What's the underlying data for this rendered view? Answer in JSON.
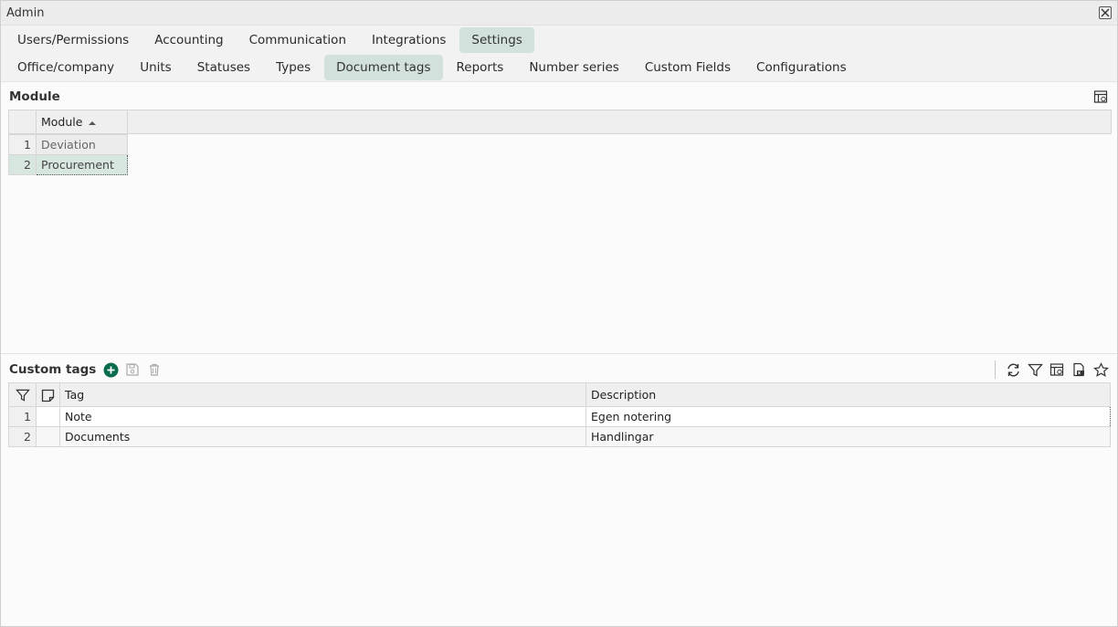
{
  "window": {
    "title": "Admin"
  },
  "tabs_row1": [
    {
      "label": "Users/Permissions"
    },
    {
      "label": "Accounting"
    },
    {
      "label": "Communication"
    },
    {
      "label": "Integrations"
    },
    {
      "label": "Settings",
      "active": true
    }
  ],
  "tabs_row2": [
    {
      "label": "Office/company"
    },
    {
      "label": "Units"
    },
    {
      "label": "Statuses"
    },
    {
      "label": "Types"
    },
    {
      "label": "Document tags",
      "active": true
    },
    {
      "label": "Reports"
    },
    {
      "label": "Number series"
    },
    {
      "label": "Custom Fields"
    },
    {
      "label": "Configurations"
    }
  ],
  "module": {
    "title": "Module",
    "column": "Module",
    "rows": [
      {
        "num": "1",
        "name": "Deviation"
      },
      {
        "num": "2",
        "name": "Procurement"
      }
    ]
  },
  "custom_tags": {
    "title": "Custom tags",
    "columns": {
      "tag": "Tag",
      "description": "Description"
    },
    "rows": [
      {
        "num": "1",
        "tag": "Note",
        "description": "Egen notering"
      },
      {
        "num": "2",
        "tag": "Documents",
        "description": "Handlingar"
      }
    ]
  },
  "colors": {
    "accent": "#0b6b4f",
    "active_tab": "#d2e1db",
    "selected_row": "#d8e6e0"
  }
}
